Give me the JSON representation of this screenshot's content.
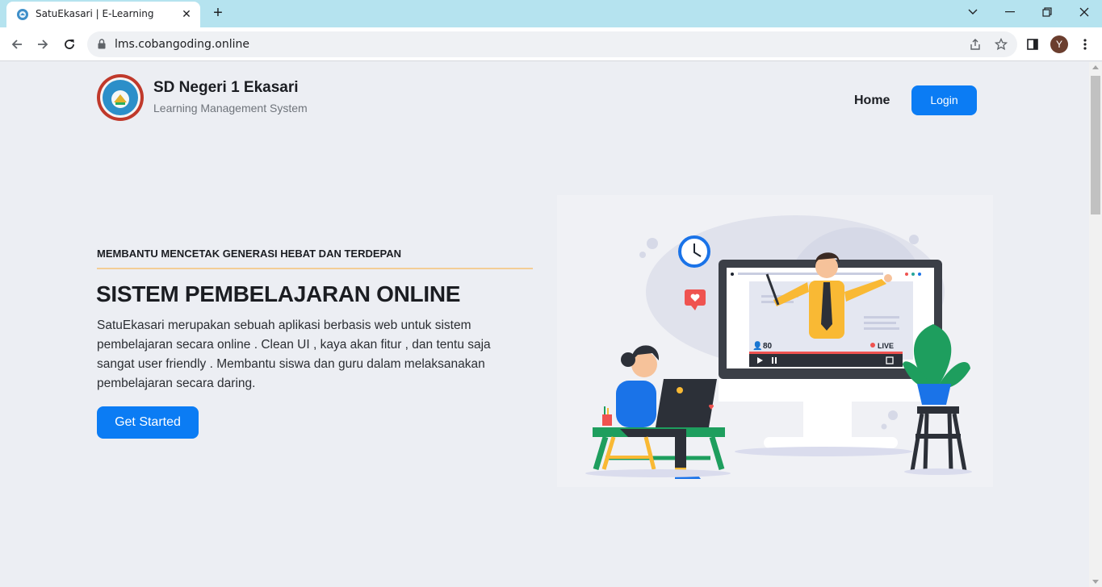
{
  "browser": {
    "tab_title": "SatuEkasari | E-Learning",
    "tab_close": "✕",
    "new_tab": "+",
    "url": "lms.cobangoding.online",
    "profile_initial": "Y"
  },
  "header": {
    "school_name": "SD Negeri 1 Ekasari",
    "tagline": "Learning Management System",
    "nav_home": "Home",
    "login_label": "Login"
  },
  "hero": {
    "eyebrow": "MEMBANTU MENCETAK GENERASI HEBAT DAN TERDEPAN",
    "title": "SISTEM PEMBELAJARAN ONLINE",
    "description": "SatuEkasari merupakan sebuah aplikasi berbasis web untuk sistem pembelajaran secara online . Clean UI , kaya akan fitur , dan tentu saja sangat user friendly . Membantu siswa dan guru dalam melaksanakan pembelajaran secara daring.",
    "cta_label": "Get Started"
  },
  "illustration": {
    "viewer_count": "80",
    "live_label": "LIVE"
  },
  "colors": {
    "accent": "#0b7cf4",
    "eyebrow_line": "#f3cd96",
    "background": "#eceef3",
    "tab_strip": "#b5e3ef"
  }
}
